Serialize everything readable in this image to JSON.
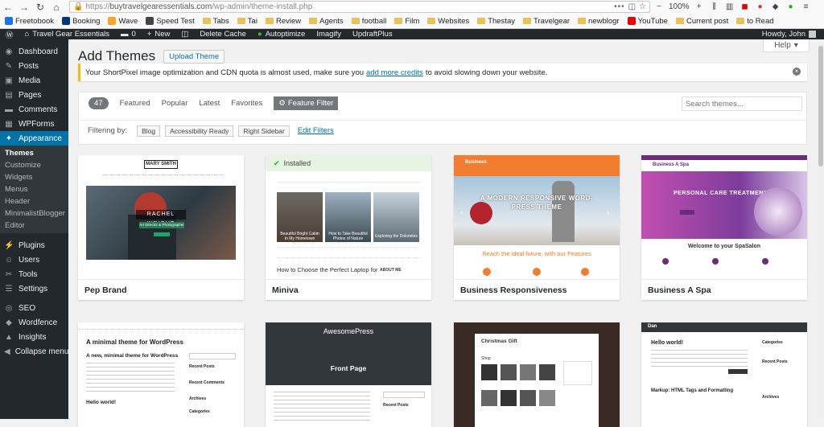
{
  "browser": {
    "url_prefix": "https://",
    "url_host": "buytravelgearessentials.com",
    "url_path": "/wp-admin/theme-install.php",
    "zoom": "100%",
    "bookmarks": [
      "Freetobook",
      "Booking",
      "Wave",
      "Speed Test",
      "Tabs",
      "Tai",
      "Review",
      "Agents",
      "football",
      "Film",
      "Websites",
      "Thestay",
      "Travelgear",
      "newblogr",
      "YouTube",
      "Current post",
      "to Read"
    ]
  },
  "adminbar": {
    "site_name": "Travel Gear Essentials",
    "comments": "0",
    "new_label": "New",
    "delete_cache": "Delete Cache",
    "autoptimize": "Autoptimize",
    "imagify": "Imagify",
    "updraft": "UpdraftPlus",
    "howdy": "Howdy, John"
  },
  "sidebar": {
    "items": [
      {
        "label": "Dashboard",
        "icon": "dashboard-icon",
        "glyph": "◉"
      },
      {
        "label": "Posts",
        "icon": "posts-icon",
        "glyph": "✎"
      },
      {
        "label": "Media",
        "icon": "media-icon",
        "glyph": "▣"
      },
      {
        "label": "Pages",
        "icon": "pages-icon",
        "glyph": "▤"
      },
      {
        "label": "Comments",
        "icon": "comments-icon",
        "glyph": "▬"
      },
      {
        "label": "WPForms",
        "icon": "wpforms-icon",
        "glyph": "▦"
      }
    ],
    "appearance": {
      "label": "Appearance",
      "glyph": "✦"
    },
    "submenu": [
      "Themes",
      "Customize",
      "Widgets",
      "Menus",
      "Header",
      "MinimalistBlogger",
      "Editor"
    ],
    "items2": [
      {
        "label": "Plugins",
        "glyph": "⚡"
      },
      {
        "label": "Users",
        "glyph": "☺"
      },
      {
        "label": "Tools",
        "glyph": "✂"
      },
      {
        "label": "Settings",
        "glyph": "☰"
      }
    ],
    "items3": [
      {
        "label": "SEO",
        "glyph": "◎"
      },
      {
        "label": "Wordfence",
        "glyph": "◆"
      },
      {
        "label": "Insights",
        "glyph": "▲"
      },
      {
        "label": "Collapse menu",
        "glyph": "◀"
      }
    ]
  },
  "page": {
    "help": "Help",
    "title": "Add Themes",
    "upload_button": "Upload Theme",
    "notice_before": "Your ShortPixel image optimization and CDN quota is almost used, make sure you",
    "notice_link": "add more credits",
    "notice_after": "to avoid slowing down your website."
  },
  "filter": {
    "count": "47",
    "tabs": [
      "Featured",
      "Popular",
      "Latest",
      "Favorites"
    ],
    "feature_filter": "Feature Filter",
    "search_placeholder": "Search themes...",
    "filtering_by": "Filtering by:",
    "tags": [
      "Blog",
      "Accessibility Ready",
      "Right Sidebar"
    ],
    "edit_filters": "Edit Filters"
  },
  "themes": [
    {
      "name": "Pep Brand",
      "installed": false
    },
    {
      "name": "Miniva",
      "installed": true,
      "installed_label": "Installed"
    },
    {
      "name": "Business Responsiveness",
      "installed": false
    },
    {
      "name": "Business A Spa",
      "installed": false
    },
    {
      "name": "",
      "installed": false
    },
    {
      "name": "",
      "installed": false
    },
    {
      "name": "",
      "installed": false
    },
    {
      "name": "",
      "installed": false
    }
  ],
  "previews": {
    "pep": {
      "logo": "MARY SMITH",
      "hero_name": "RACHEL WRIGHT",
      "hero_sub": "Art Director & Photographer"
    },
    "miniva": {
      "cap1": "Beautiful Bright Cabin In My Hometown",
      "cap2": "How to Take Beautiful Photos of Nature",
      "cap3": "Exploring the Dolomites",
      "post": "How to Choose the Perfect Laptop for",
      "about": "ABOUT ME"
    },
    "busresp": {
      "logo": "Business",
      "hero": "A MODERN RESPONSIVE WORD-PRESS THEME",
      "tagline": "Reach the ideal future, with our Features"
    },
    "spa": {
      "logo": "Business A Spa",
      "hero": "PERSONAL CARE TREATMENT",
      "welcome": "Welcome to your SpaSalon"
    },
    "minimal": {
      "title": "A minimal theme for WordPress",
      "post1": "A new, minimal theme for WordPress",
      "post2": "Hello world!",
      "sidebar1": "Recent Posts",
      "sidebar2": "Recent Comments",
      "sidebar3": "Archives",
      "sidebar4": "Categories"
    },
    "awesome": {
      "logo": "AwesomePress",
      "hero": "Front Page",
      "widget": "Recent Posts"
    },
    "christmas": {
      "title": "Christmas Gift",
      "sub": "Shop"
    },
    "dan": {
      "logo": "Dan",
      "post1": "Hello world!",
      "post2": "Markup: HTML Tags and Formatting",
      "side1": "Categories",
      "side2": "Recent Posts",
      "side3": "Archives"
    }
  }
}
